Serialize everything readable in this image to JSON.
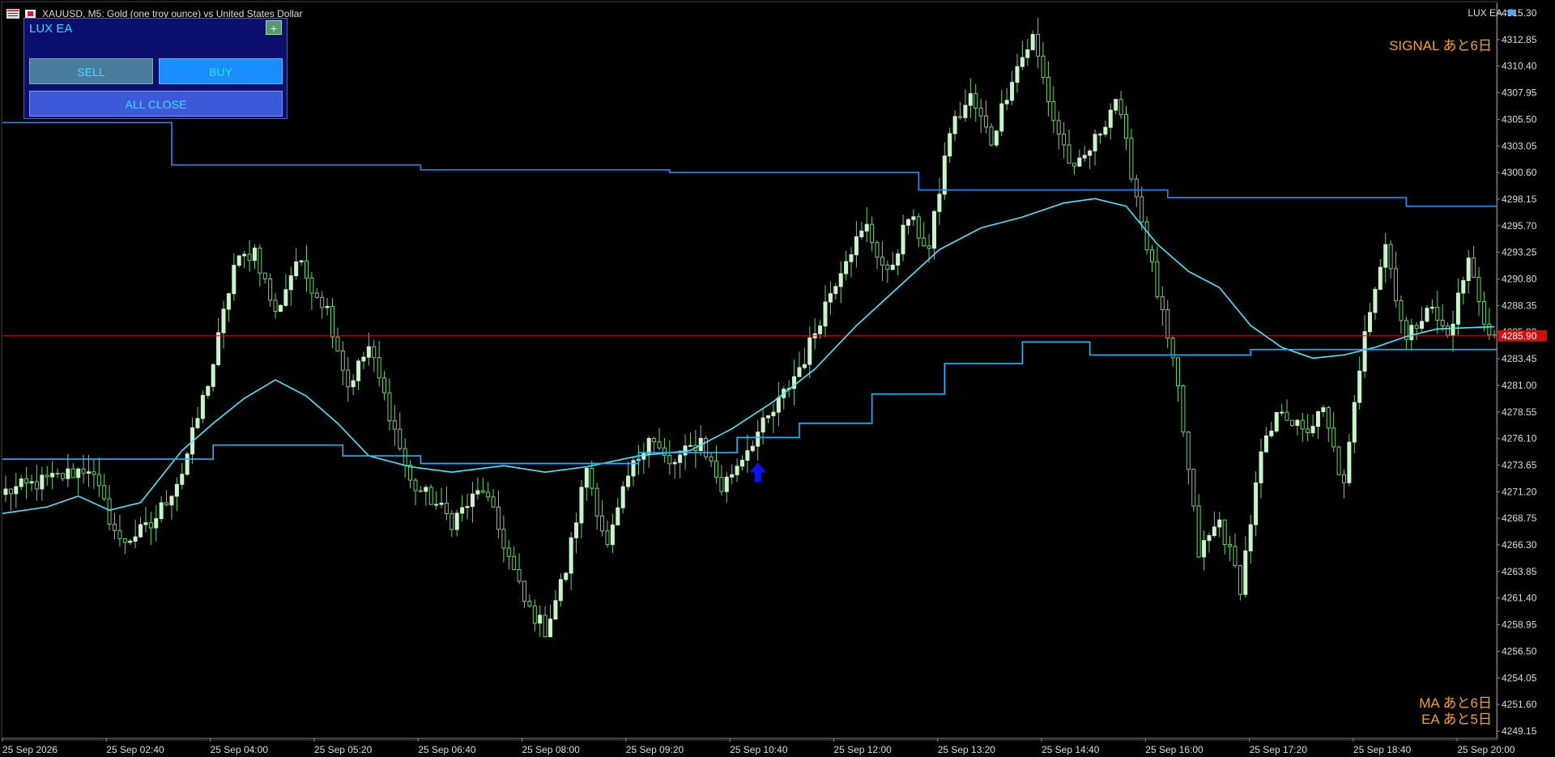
{
  "window": {
    "symbol_title": "XAUUSD, M5:  Gold (one troy ounce) vs United States Dollar",
    "indicator_label": "LUX EA"
  },
  "panel": {
    "title": "LUX EA",
    "plus_label": "+",
    "sell_label": "SELL",
    "buy_label": "BUY",
    "close_label": "ALL CLOSE"
  },
  "countdowns": {
    "signal": "SIGNAL あと6日",
    "ma": "MA あと6日",
    "ea": "EA あと5日"
  },
  "colors": {
    "background": "#000000",
    "candle_up": "#c8f5c8",
    "candle_down": "#000000",
    "wick": "#6fd06f",
    "line_cyan": "#4de8ff",
    "line_mid": "#1fb4ff",
    "line_blue": "#1a8cff",
    "current_price_line": "#cc1111",
    "signal_arrow": "#1010ff",
    "text_orange": "#f0a030"
  },
  "chart_data": {
    "type": "candlestick",
    "symbol": "XAUUSD",
    "timeframe": "M5",
    "price_axis": [
      "4315.30",
      "4312.85",
      "4310.40",
      "4307.95",
      "4305.50",
      "4303.05",
      "4300.60",
      "4298.15",
      "4295.70",
      "4293.25",
      "4290.80",
      "4288.35",
      "4285.90",
      "4283.45",
      "4281.00",
      "4278.55",
      "4276.10",
      "4273.65",
      "4271.20",
      "4268.75",
      "4266.30",
      "4263.85",
      "4261.40",
      "4258.95",
      "4256.50",
      "4254.05",
      "4251.60",
      "4249.15"
    ],
    "ylim": [
      4247.0,
      4316.2
    ],
    "current_price": 4285.56,
    "current_price_label": "4285.90",
    "time_axis": [
      "25 Sep 2026",
      "25 Sep 02:40",
      "25 Sep 04:00",
      "25 Sep 05:20",
      "25 Sep 06:40",
      "25 Sep 08:00",
      "25 Sep 09:20",
      "25 Sep 10:40",
      "25 Sep 12:00",
      "25 Sep 13:20",
      "25 Sep 14:40",
      "25 Sep 16:00",
      "25 Sep 17:20",
      "25 Sep 18:40",
      "25 Sep 20:00"
    ],
    "bar_count": 240,
    "close_anchors": [
      [
        0,
        4271.2
      ],
      [
        10,
        4272.5
      ],
      [
        16,
        4273.5
      ],
      [
        22,
        4266.5
      ],
      [
        28,
        4268.0
      ],
      [
        34,
        4273.0
      ],
      [
        40,
        4283.0
      ],
      [
        44,
        4292.0
      ],
      [
        48,
        4293.5
      ],
      [
        52,
        4287.5
      ],
      [
        56,
        4292.5
      ],
      [
        62,
        4288.0
      ],
      [
        66,
        4281.0
      ],
      [
        70,
        4284.5
      ],
      [
        74,
        4278.5
      ],
      [
        78,
        4272.0
      ],
      [
        82,
        4270.5
      ],
      [
        86,
        4268.5
      ],
      [
        92,
        4271.5
      ],
      [
        96,
        4266.5
      ],
      [
        100,
        4261.0
      ],
      [
        104,
        4258.5
      ],
      [
        108,
        4264.0
      ],
      [
        112,
        4273.5
      ],
      [
        116,
        4266.0
      ],
      [
        120,
        4272.5
      ],
      [
        124,
        4276.5
      ],
      [
        128,
        4273.5
      ],
      [
        134,
        4276.0
      ],
      [
        138,
        4271.5
      ],
      [
        144,
        4276.0
      ],
      [
        148,
        4278.5
      ],
      [
        154,
        4283.5
      ],
      [
        158,
        4288.5
      ],
      [
        162,
        4293.0
      ],
      [
        166,
        4295.5
      ],
      [
        170,
        4291.0
      ],
      [
        174,
        4296.5
      ],
      [
        178,
        4293.5
      ],
      [
        182,
        4304.5
      ],
      [
        186,
        4307.5
      ],
      [
        190,
        4303.5
      ],
      [
        194,
        4309.5
      ],
      [
        198,
        4313.0
      ],
      [
        202,
        4305.5
      ],
      [
        206,
        4300.5
      ],
      [
        210,
        4303.5
      ],
      [
        214,
        4307.5
      ],
      [
        218,
        4298.5
      ],
      [
        222,
        4289.5
      ],
      [
        226,
        4280.5
      ],
      [
        230,
        4265.5
      ],
      [
        234,
        4268.5
      ],
      [
        238,
        4262.5
      ],
      [
        242,
        4274.5
      ],
      [
        246,
        4279.0
      ],
      [
        250,
        4276.5
      ],
      [
        254,
        4278.5
      ],
      [
        258,
        4271.5
      ],
      [
        262,
        4286.5
      ],
      [
        266,
        4294.0
      ],
      [
        270,
        4285.0
      ],
      [
        274,
        4288.5
      ],
      [
        278,
        4285.5
      ],
      [
        282,
        4292.5
      ],
      [
        286,
        4285.5
      ]
    ],
    "series": [
      {
        "name": "",
        "role": "upper-band",
        "steps": [
          [
            0,
            4305.2
          ],
          [
            31,
            4305.2
          ],
          [
            32,
            4301.3
          ],
          [
            79,
            4301.3
          ],
          [
            80,
            4300.85
          ],
          [
            127,
            4300.85
          ],
          [
            128,
            4300.6
          ],
          [
            175,
            4300.6
          ],
          [
            176,
            4299.0
          ],
          [
            223,
            4299.0
          ],
          [
            224,
            4298.3
          ],
          [
            269,
            4298.3
          ],
          [
            270,
            4297.5
          ],
          [
            287,
            4297.5
          ]
        ]
      },
      {
        "name": "",
        "role": "slow-line",
        "points": [
          [
            0,
            4269.2
          ],
          [
            8,
            4269.8
          ],
          [
            14,
            4270.8
          ],
          [
            20,
            4269.5
          ],
          [
            26,
            4270.2
          ],
          [
            34,
            4275.0
          ],
          [
            40,
            4277.5
          ],
          [
            46,
            4279.8
          ],
          [
            52,
            4281.5
          ],
          [
            58,
            4280.0
          ],
          [
            64,
            4277.5
          ],
          [
            70,
            4274.5
          ],
          [
            78,
            4273.5
          ],
          [
            86,
            4273.0
          ],
          [
            96,
            4273.6
          ],
          [
            104,
            4273.0
          ],
          [
            112,
            4273.5
          ],
          [
            122,
            4274.5
          ],
          [
            132,
            4275.0
          ],
          [
            140,
            4277.0
          ],
          [
            148,
            4279.5
          ],
          [
            156,
            4282.5
          ],
          [
            164,
            4286.5
          ],
          [
            172,
            4290.0
          ],
          [
            180,
            4293.5
          ],
          [
            188,
            4295.5
          ],
          [
            196,
            4296.5
          ],
          [
            204,
            4297.8
          ],
          [
            210,
            4298.2
          ],
          [
            216,
            4297.5
          ],
          [
            222,
            4294.0
          ],
          [
            228,
            4291.5
          ],
          [
            234,
            4290.0
          ],
          [
            240,
            4286.5
          ],
          [
            246,
            4284.5
          ],
          [
            252,
            4283.5
          ],
          [
            258,
            4283.8
          ],
          [
            264,
            4284.5
          ],
          [
            270,
            4285.5
          ],
          [
            276,
            4286.2
          ],
          [
            287,
            4286.4
          ]
        ]
      },
      {
        "name": "",
        "role": "mid-line",
        "steps": [
          [
            0,
            4274.2
          ],
          [
            39,
            4274.2
          ],
          [
            40,
            4275.5
          ],
          [
            64,
            4275.5
          ],
          [
            65,
            4274.5
          ],
          [
            79,
            4274.5
          ],
          [
            80,
            4273.8
          ],
          [
            121,
            4273.8
          ],
          [
            122,
            4274.8
          ],
          [
            140,
            4274.8
          ],
          [
            141,
            4276.2
          ],
          [
            152,
            4276.2
          ],
          [
            153,
            4277.5
          ],
          [
            166,
            4277.5
          ],
          [
            167,
            4280.2
          ],
          [
            180,
            4280.2
          ],
          [
            181,
            4283.0
          ],
          [
            195,
            4283.0
          ],
          [
            196,
            4285.0
          ],
          [
            208,
            4285.0
          ],
          [
            209,
            4283.8
          ],
          [
            239,
            4283.8
          ],
          [
            240,
            4284.3
          ],
          [
            287,
            4284.3
          ]
        ]
      }
    ],
    "signals": [
      {
        "type": "buy-arrow",
        "bar": 145,
        "price": 4273.0
      }
    ]
  }
}
